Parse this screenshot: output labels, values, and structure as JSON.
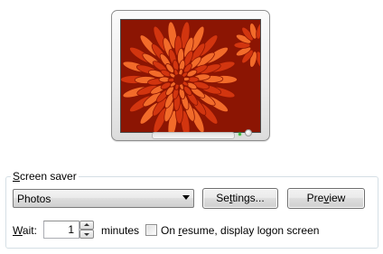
{
  "preview": {
    "image_description_icon": "chrysanthemum-photo",
    "colors": {
      "petal_dark": "#8c1503",
      "petal_mid": "#d2350f",
      "petal_light": "#f26b2a"
    }
  },
  "screen_saver": {
    "group_label_prefix": "S",
    "group_label_rest": "creen saver",
    "selected": "Photos",
    "settings_label_prefix": "Se",
    "settings_label_accel": "t",
    "settings_label_rest": "tings...",
    "preview_label_prefix": "Pre",
    "preview_label_accel": "v",
    "preview_label_rest": "iew"
  },
  "wait": {
    "label_accel": "W",
    "label_rest": "ait:",
    "value": "1",
    "unit": "minutes",
    "resume_prefix": "On ",
    "resume_accel": "r",
    "resume_rest": "esume, display logon screen",
    "resume_checked": false
  }
}
